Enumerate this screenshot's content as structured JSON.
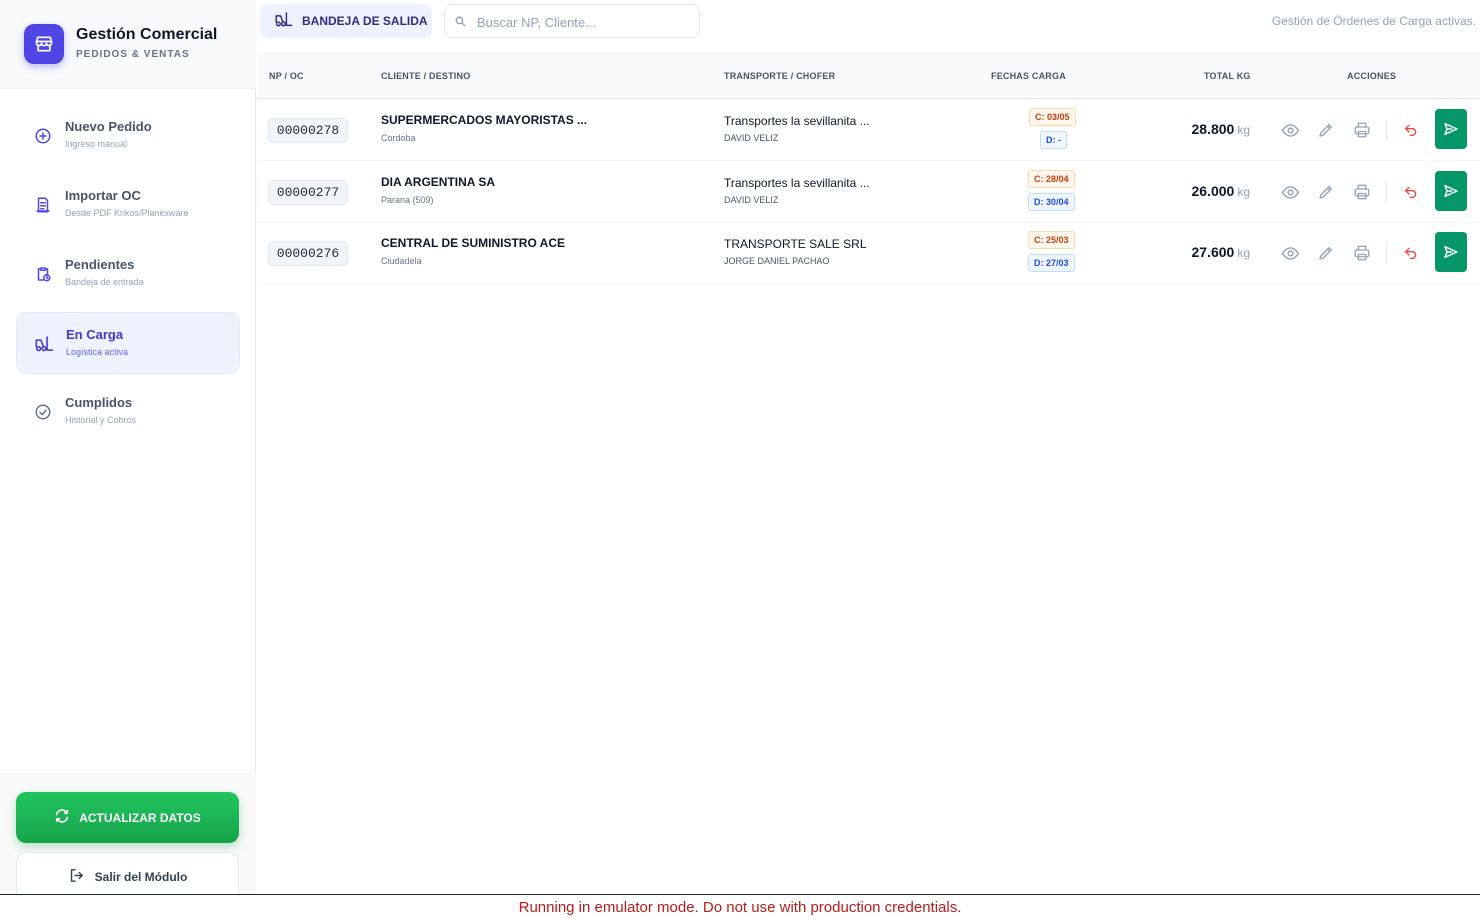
{
  "brand": {
    "title": "Gestión Comercial",
    "subtitle": "PEDIDOS & VENTAS"
  },
  "nav": [
    {
      "label": "Nuevo Pedido",
      "sub": "Ingreso manual",
      "icon": "plus-circle-icon"
    },
    {
      "label": "Importar OC",
      "sub": "Desde PDF Krikos/Planexware",
      "icon": "document-import-icon"
    },
    {
      "label": "Pendientes",
      "sub": "Bandeja de entrada",
      "icon": "clipboard-clock-icon"
    },
    {
      "label": "En Carga",
      "sub": "Logística activa",
      "icon": "forklift-icon",
      "active": true
    },
    {
      "label": "Cumplidos",
      "sub": "Historial y Cobros",
      "icon": "check-circle-icon"
    }
  ],
  "actions": {
    "refresh_label": "ACTUALIZAR DATOS",
    "exit_label": "Salir del Módulo"
  },
  "header": {
    "tab_label": "BANDEJA DE SALIDA",
    "search_placeholder": "Buscar NP, Cliente...",
    "search_value": "",
    "hint": "Gestión de Órdenes de Carga activas."
  },
  "table": {
    "columns": [
      "NP / OC",
      "CLIENTE / DESTINO",
      "TRANSPORTE / CHOFER",
      "FECHAS CARGA",
      "TOTAL KG",
      "ACCIONES"
    ],
    "rows": [
      {
        "np": "00000278",
        "cliente": "SUPERMERCADOS MAYORISTAS ...",
        "destino": "Cordoba",
        "transporte": "Transportes la sevillanita ...",
        "chofer": "DAVID VELIZ",
        "fecha_c": "C: 03/05",
        "fecha_d": "D: -",
        "kg": "28.800",
        "unit": "kg"
      },
      {
        "np": "00000277",
        "cliente": "DIA ARGENTINA SA",
        "destino": "Parana (509)",
        "transporte": "Transportes la sevillanita ...",
        "chofer": "DAVID VELIZ",
        "fecha_c": "C: 28/04",
        "fecha_d": "D: 30/04",
        "kg": "26.000",
        "unit": "kg"
      },
      {
        "np": "00000276",
        "cliente": "CENTRAL DE SUMINISTRO ACE",
        "destino": "Ciudadela",
        "transporte": "TRANSPORTE SALE SRL",
        "chofer": "JORGE DANIEL PACHAO",
        "fecha_c": "C: 25/03",
        "fecha_d": "D: 27/03",
        "kg": "27.600",
        "unit": "kg"
      }
    ]
  },
  "footer": {
    "message": "Running in emulator mode. Do not use with production credentials."
  },
  "colors": {
    "accent": "#4f46e5",
    "success": "#16a34a",
    "send": "#059669",
    "danger": "#ef4444"
  }
}
